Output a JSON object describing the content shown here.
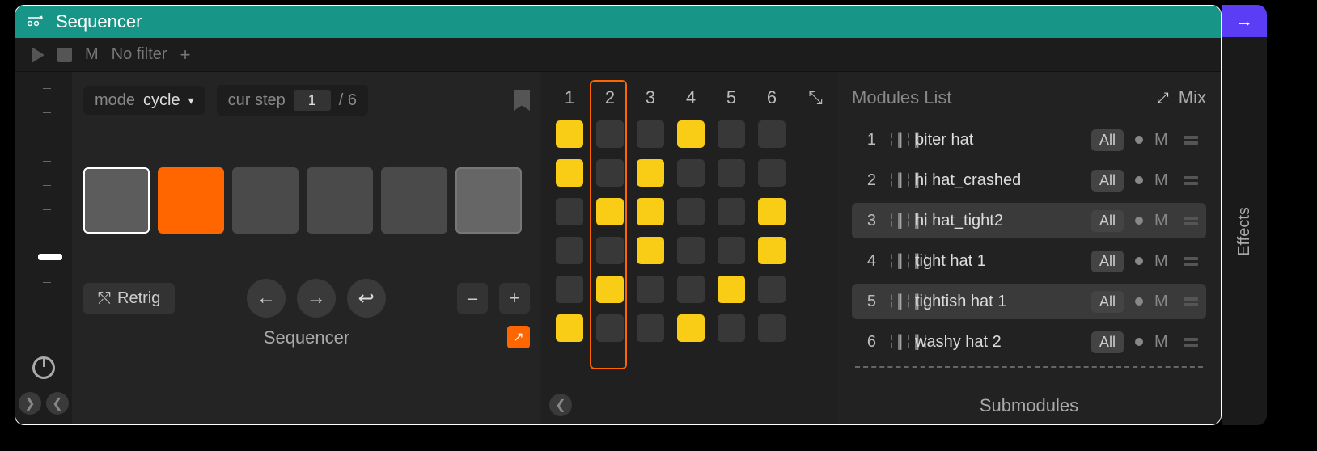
{
  "window": {
    "title": "Sequencer"
  },
  "toolbar": {
    "m": "M",
    "filter": "No filter",
    "plus": "+"
  },
  "params": {
    "mode_label": "mode",
    "mode_value": "cycle",
    "curstep_label": "cur step",
    "curstep_value": "1",
    "curstep_total": "/ 6"
  },
  "retrig": {
    "label": "Retrig"
  },
  "buttons": {
    "minus": "–",
    "plus": "+"
  },
  "footer": {
    "left": "Sequencer",
    "right": "Submodules"
  },
  "grid": {
    "cols": [
      "1",
      "2",
      "3",
      "4",
      "5",
      "6"
    ],
    "pattern": [
      [
        1,
        0,
        0,
        1,
        0,
        0
      ],
      [
        1,
        0,
        1,
        0,
        0,
        0
      ],
      [
        0,
        1,
        1,
        0,
        0,
        1
      ],
      [
        0,
        0,
        1,
        0,
        0,
        1
      ],
      [
        0,
        1,
        0,
        0,
        1,
        0
      ],
      [
        1,
        0,
        0,
        1,
        0,
        0
      ]
    ],
    "highlight_col": 2
  },
  "modules": {
    "title": "Modules List",
    "mix": "Mix",
    "all": "All",
    "m": "M",
    "rows": [
      {
        "n": "1",
        "name": "biter hat",
        "sel": false
      },
      {
        "n": "2",
        "name": "hi hat_crashed",
        "sel": false
      },
      {
        "n": "3",
        "name": "hi hat_tight2",
        "sel": true
      },
      {
        "n": "4",
        "name": "tight hat 1",
        "sel": false
      },
      {
        "n": "5",
        "name": "tightish hat 1",
        "sel": true
      },
      {
        "n": "6",
        "name": "washy hat 2",
        "sel": false
      }
    ]
  },
  "side": {
    "label": "Effects"
  }
}
